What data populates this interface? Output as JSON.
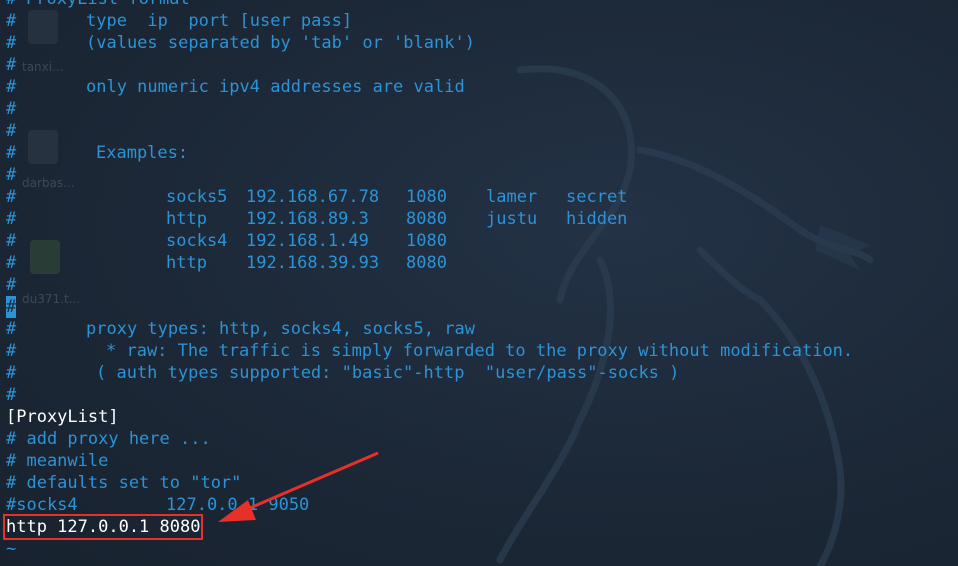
{
  "editor": {
    "lines": [
      {
        "hash": "#",
        "segments": [
          {
            "text": "ProxyList format"
          }
        ]
      },
      {
        "hash": "#",
        "segments": [
          {
            "text": "type  ip  port [user pass]"
          }
        ]
      },
      {
        "hash": "#",
        "segments": [
          {
            "text": "(values separated by 'tab' or 'blank')"
          }
        ]
      },
      {
        "hash": "#",
        "segments": []
      },
      {
        "hash": "#",
        "segments": [
          {
            "text": "only numeric ipv4 addresses are valid"
          }
        ]
      },
      {
        "hash": "#",
        "segments": []
      },
      {
        "hash": "#",
        "segments": []
      },
      {
        "hash": "#",
        "segments": [
          {
            "text": "Examples:"
          }
        ]
      },
      {
        "hash": "#",
        "segments": []
      },
      {
        "hash": "#",
        "segments": [
          {
            "text": "socks5"
          },
          {
            "text": "192.168.67.78"
          },
          {
            "text": "1080"
          },
          {
            "text": "lamer"
          },
          {
            "text": "secret"
          }
        ]
      },
      {
        "hash": "#",
        "segments": [
          {
            "text": "http"
          },
          {
            "text": "192.168.89.3"
          },
          {
            "text": "8080"
          },
          {
            "text": "justu"
          },
          {
            "text": "hidden"
          }
        ]
      },
      {
        "hash": "#",
        "segments": [
          {
            "text": "socks4"
          },
          {
            "text": "192.168.1.49"
          },
          {
            "text": "1080"
          }
        ]
      },
      {
        "hash": "#",
        "segments": [
          {
            "text": "http"
          },
          {
            "text": "192.168.39.93"
          },
          {
            "text": "8080"
          }
        ]
      },
      {
        "hash": "#",
        "segments": []
      },
      {
        "hash": "#",
        "segments": [],
        "cursor": true
      },
      {
        "hash": "#",
        "segments": [
          {
            "text": "proxy types: http, socks4, socks5, raw"
          }
        ]
      },
      {
        "hash": "#",
        "segments": [
          {
            "text": "* raw: The traffic is simply forwarded to the proxy without modification."
          }
        ]
      },
      {
        "hash": "#",
        "segments": [
          {
            "text": "( auth types supported: \"basic\"-http  \"user/pass\"-socks )"
          }
        ]
      },
      {
        "hash": "#",
        "segments": []
      },
      {
        "hash": "",
        "segments": [
          {
            "text": "[ProxyList]"
          }
        ],
        "style": "white"
      },
      {
        "hash": "",
        "segments": [
          {
            "text": "# add proxy here ..."
          }
        ]
      },
      {
        "hash": "",
        "segments": [
          {
            "text": "# meanwile"
          }
        ]
      },
      {
        "hash": "",
        "segments": [
          {
            "text": "# defaults set to \"tor\""
          }
        ]
      },
      {
        "hash": "",
        "segments": [
          {
            "text": "#socks4"
          },
          {
            "text": "127.0.0.1 9050"
          }
        ]
      },
      {
        "hash": "",
        "segments": [
          {
            "text": "http 127.0.0.1 8080"
          }
        ],
        "style": "white"
      },
      {
        "hash": "",
        "segments": [
          {
            "text": "~"
          }
        ]
      }
    ]
  },
  "desktop": {
    "labels": [
      "tanxi...",
      "darbas...",
      "du371.t..."
    ]
  },
  "annotation": {
    "highlight_color": "#e8302a"
  }
}
